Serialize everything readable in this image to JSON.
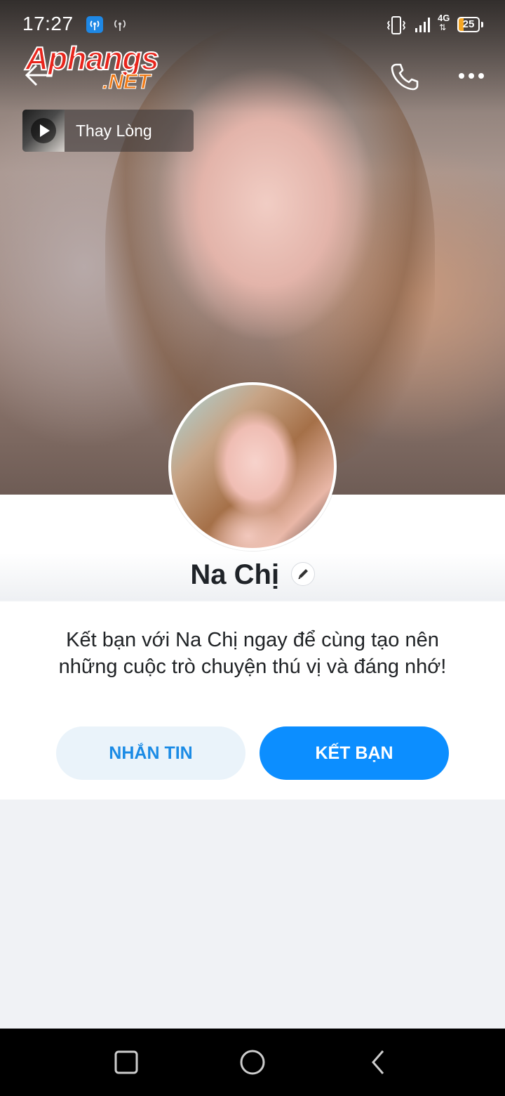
{
  "status_bar": {
    "time": "17:27",
    "network": "4G",
    "battery": "25",
    "icons": [
      "hotspot-icon",
      "wifi-calling-icon",
      "vibrate-icon",
      "signal-icon",
      "battery-icon"
    ]
  },
  "watermark": {
    "line1": "Aphangs",
    "line2": ".NET"
  },
  "top_bar": {
    "icons": [
      "back-arrow-icon",
      "phone-icon",
      "more-icon"
    ]
  },
  "music": {
    "title": "Thay Lòng"
  },
  "profile": {
    "name": "Na Chị",
    "intro": "Kết bạn với Na Chị ngay để cùng tạo nên những cuộc trò chuyện thú vị và đáng nhớ!"
  },
  "actions": {
    "message_label": "NHẮN TIN",
    "add_friend_label": "KẾT BẠN"
  },
  "nav": {
    "icons": [
      "recents-square-icon",
      "home-circle-icon",
      "back-triangle-icon"
    ]
  },
  "colors": {
    "primary": "#0c8eff",
    "secondary_bg": "#eaf3fa",
    "page_bg": "#f0f2f5"
  }
}
